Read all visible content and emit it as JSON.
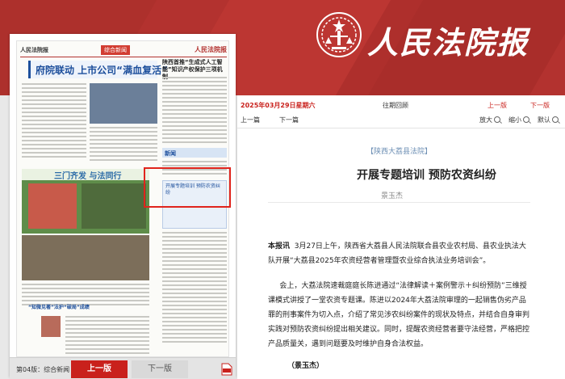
{
  "brand": {
    "name": "人民法院报"
  },
  "newspaper": {
    "header_left": "人民法院报",
    "header_section": "综合新闻",
    "header_right": "人民法院报",
    "headline": "府院联动 上市公司“满血复活”",
    "side_headline": "陕西首推“生成式人工智能”知识产权保护三项机制",
    "section_title": "三门齐发 与法同行",
    "blue_box_text": "开展专题培训 预防农资纠纷",
    "bottom_heading": "“知微见著”法护“破局”成绩",
    "edition_label": "第04版：综合新闻",
    "prev_page": "上一版",
    "next_page": "下一版",
    "pdf_icon": "pdf-icon"
  },
  "nav": {
    "date": "2025年03月29日星期六",
    "past_review": "往期回顾",
    "prev_page": "上一版",
    "next_page": "下一版",
    "prev_article": "上一篇",
    "next_article": "下一篇",
    "zoom_in": "放大",
    "zoom_out": "缩小",
    "default": "默认"
  },
  "article": {
    "column_tag": "【陕西大荔县法院】",
    "title": "开展专题培训 预防农资纠纷",
    "author": "景玉杰",
    "lead": "本报讯",
    "para1": "3月27日上午，陕西省大荔县人民法院联合县农业农村局、县农业执法大队开展“大荔县2025年农资经营者管理暨农业综合执法业务培训会”。",
    "para2": "会上，大荔法院速裁庭庭长陈进通过“法律解读＋案例警示＋纠纷预防”三维授课模式讲授了一堂农资专题课。陈进以2024年大荔法院审理的一起销售伪劣产品罪的刑事案件为切入点，介绍了常见涉农纠纷案件的现状及特点，并结合自身审判实践对预防农资纠纷提出相关建议。同时，提醒农资经营者要守法经营，严格把控产品质量关，遇到问题要及时维护自身合法权益。",
    "signature": "（景玉杰）"
  }
}
